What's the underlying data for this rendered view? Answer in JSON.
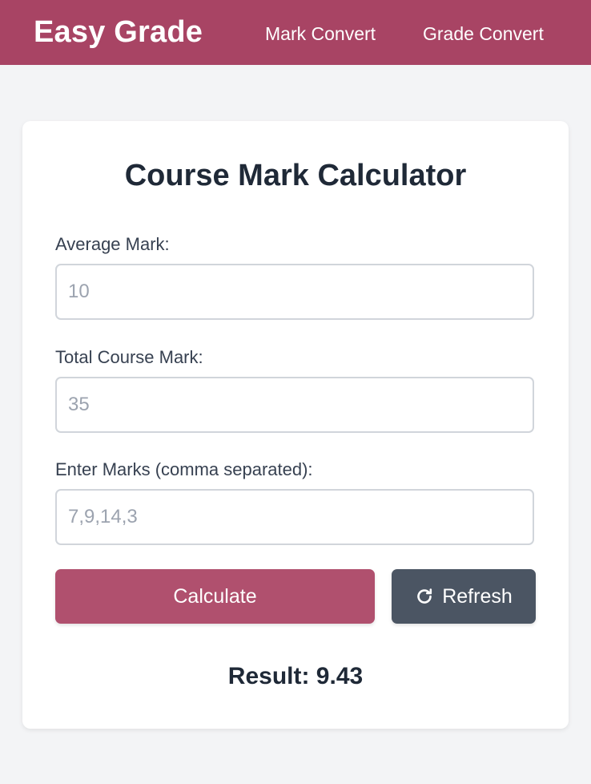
{
  "nav": {
    "brand": "Easy Grade",
    "links": [
      "Mark Convert",
      "Grade Convert"
    ]
  },
  "form": {
    "title": "Course Mark Calculator",
    "average_mark": {
      "label": "Average Mark:",
      "placeholder": "10",
      "value": ""
    },
    "total_course_mark": {
      "label": "Total Course Mark:",
      "placeholder": "35",
      "value": ""
    },
    "marks": {
      "label": "Enter Marks (comma separated):",
      "placeholder": "7,9,14,3",
      "value": ""
    },
    "calculate_label": "Calculate",
    "refresh_label": "Refresh",
    "refresh_icon": "refresh-icon"
  },
  "result": {
    "text": "Result: 9.43"
  },
  "colors": {
    "navbar": "#a84464",
    "calculate_button": "#b0506e",
    "refresh_button": "#4b5563",
    "page_background": "#f3f4f6"
  }
}
